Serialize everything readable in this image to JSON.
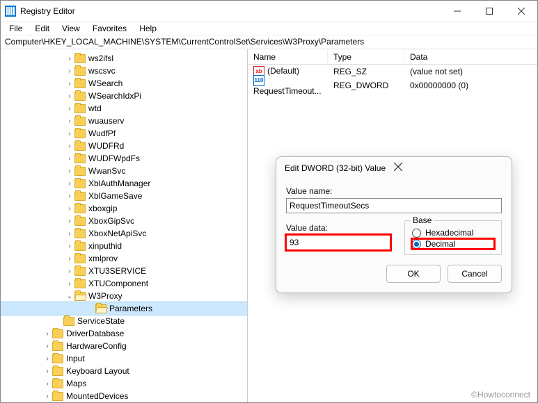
{
  "window": {
    "title": "Registry Editor"
  },
  "menu": {
    "file": "File",
    "edit": "Edit",
    "view": "View",
    "favorites": "Favorites",
    "help": "Help"
  },
  "address": "Computer\\HKEY_LOCAL_MACHINE\\SYSTEM\\CurrentControlSet\\Services\\W3Proxy\\Parameters",
  "tree": {
    "top": [
      "ws2ifsl",
      "wscsvc",
      "WSearch",
      "WSearchIdxPi",
      "wtd",
      "wuauserv",
      "WudfPf",
      "WUDFRd",
      "WUDFWpdFs",
      "WwanSvc",
      "XblAuthManager",
      "XblGameSave",
      "xboxgip",
      "XboxGipSvc",
      "XboxNetApiSvc",
      "xinputhid",
      "xmlprov",
      "XTU3SERVICE",
      "XTUComponent"
    ],
    "w3proxy": "W3Proxy",
    "parameters": "Parameters",
    "servicestate": "ServiceState",
    "siblings": [
      "DriverDatabase",
      "HardwareConfig",
      "Input",
      "Keyboard Layout",
      "Maps",
      "MountedDevices"
    ]
  },
  "list": {
    "headers": {
      "name": "Name",
      "type": "Type",
      "data": "Data"
    },
    "rows": [
      {
        "icon": "str",
        "name": "(Default)",
        "type": "REG_SZ",
        "data": "(value not set)"
      },
      {
        "icon": "bin",
        "name": "RequestTimeout...",
        "type": "REG_DWORD",
        "data": "0x00000000 (0)"
      }
    ]
  },
  "dialog": {
    "title": "Edit DWORD (32-bit) Value",
    "value_name_label": "Value name:",
    "value_name": "RequestTimeoutSecs",
    "value_data_label": "Value data:",
    "value_data": "93",
    "base_label": "Base",
    "radio_hex": "Hexadecimal",
    "radio_dec": "Decimal",
    "ok": "OK",
    "cancel": "Cancel"
  },
  "watermark": "©Howtoconnect"
}
